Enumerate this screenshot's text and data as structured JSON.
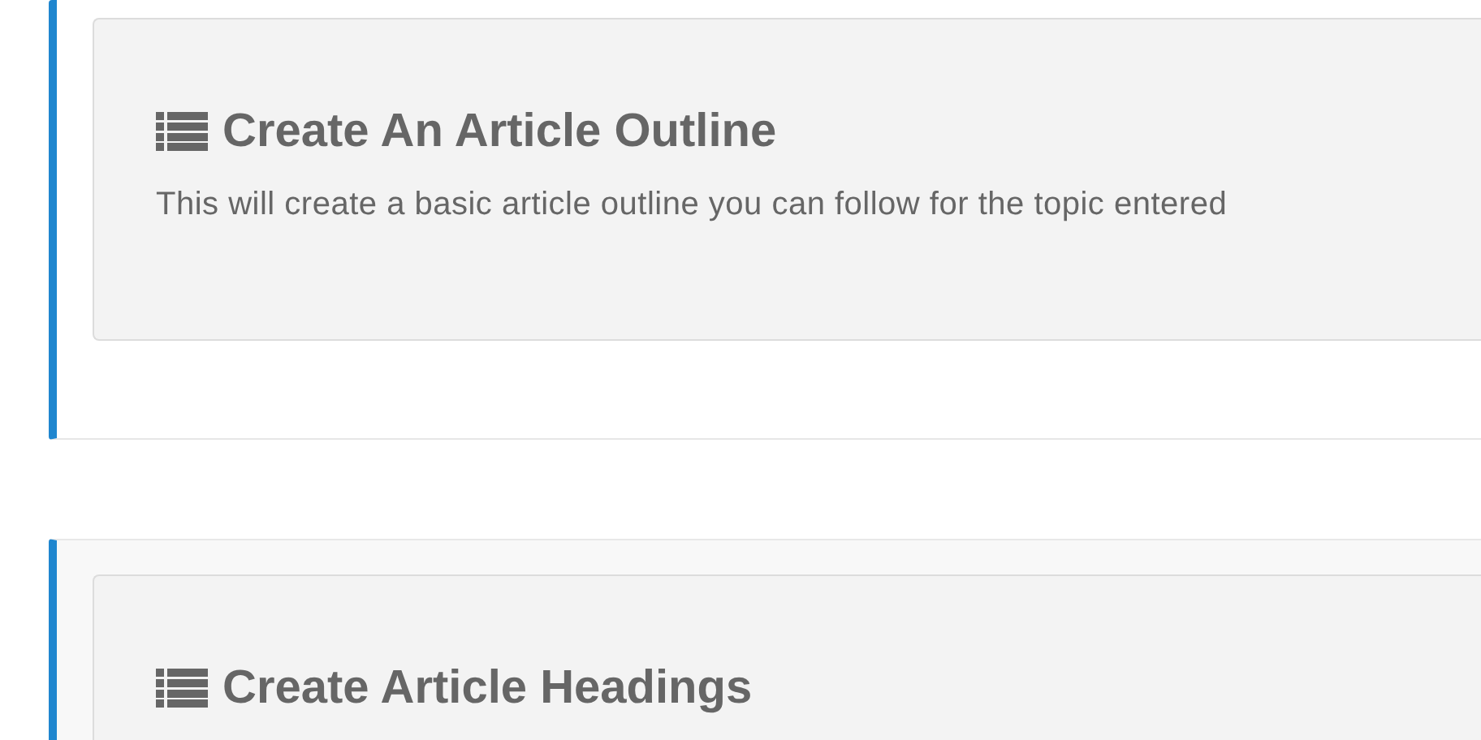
{
  "sections": [
    {
      "title": "Create An Article Outline",
      "description": "This will create a basic article outline you can follow for the topic entered",
      "highlighted": false
    },
    {
      "title": "Create Article Headings",
      "highlighted": true
    }
  ]
}
